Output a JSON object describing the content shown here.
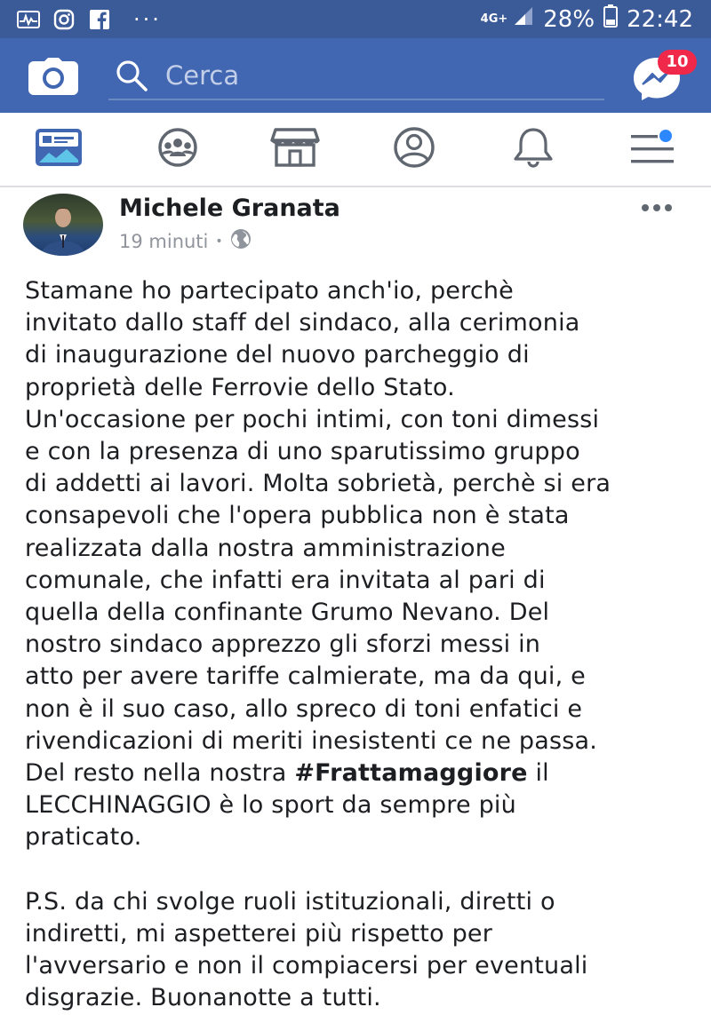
{
  "status_bar": {
    "battery_percent": "28%",
    "time": "22:42",
    "network": "4G+",
    "icons": [
      "activity-icon",
      "instagram-icon",
      "facebook-icon",
      "more-notifications-icon",
      "signal-icon",
      "battery-icon"
    ]
  },
  "top_bar": {
    "search_placeholder": "Cerca",
    "messenger_badge": "10",
    "color": "#4267b2"
  },
  "nav": {
    "items": [
      "news-feed-icon",
      "groups-icon",
      "marketplace-icon",
      "profile-icon",
      "notifications-icon",
      "menu-icon"
    ]
  },
  "post": {
    "author": "Michele Granata",
    "time": "19 minuti",
    "separator": "•",
    "paragraph1_lines": [
      "Stamane ho partecipato anch'io, perchè",
      "invitato dallo staff del sindaco, alla cerimonia",
      "di inaugurazione del nuovo parcheggio di",
      "proprietà delle Ferrovie dello Stato.",
      "Un'occasione per pochi intimi, con toni dimessi",
      "e con la presenza di uno sparutissimo gruppo",
      "di addetti ai lavori. Molta sobrietà, perchè si era",
      "consapevoli che l'opera pubblica non è stata",
      "realizzata dalla nostra amministrazione",
      "comunale, che infatti era invitata al pari di",
      "quella della confinante Grumo Nevano. Del",
      "nostro sindaco apprezzo gli sforzi messi in",
      "atto per avere tariffe calmierate, ma da qui, e",
      "non è il suo caso, allo spreco di toni enfatici e",
      "rivendicazioni di meriti inesistenti ce ne passa."
    ],
    "hashtag_line_prefix": "Del resto nella nostra ",
    "hashtag": "#Frattamaggiore",
    "hashtag_line_suffix": " il",
    "paragraph1_tail": [
      "LECCHINAGGIO è lo sport da sempre più",
      "praticato."
    ],
    "paragraph2_lines": [
      "P.S. da chi svolge ruoli istituzionali, diretti o",
      "indiretti, mi aspetterei più rispetto per",
      "l'avversario e non il compiacersi per eventuali",
      "disgrazie. Buonanotte a tutti."
    ]
  }
}
